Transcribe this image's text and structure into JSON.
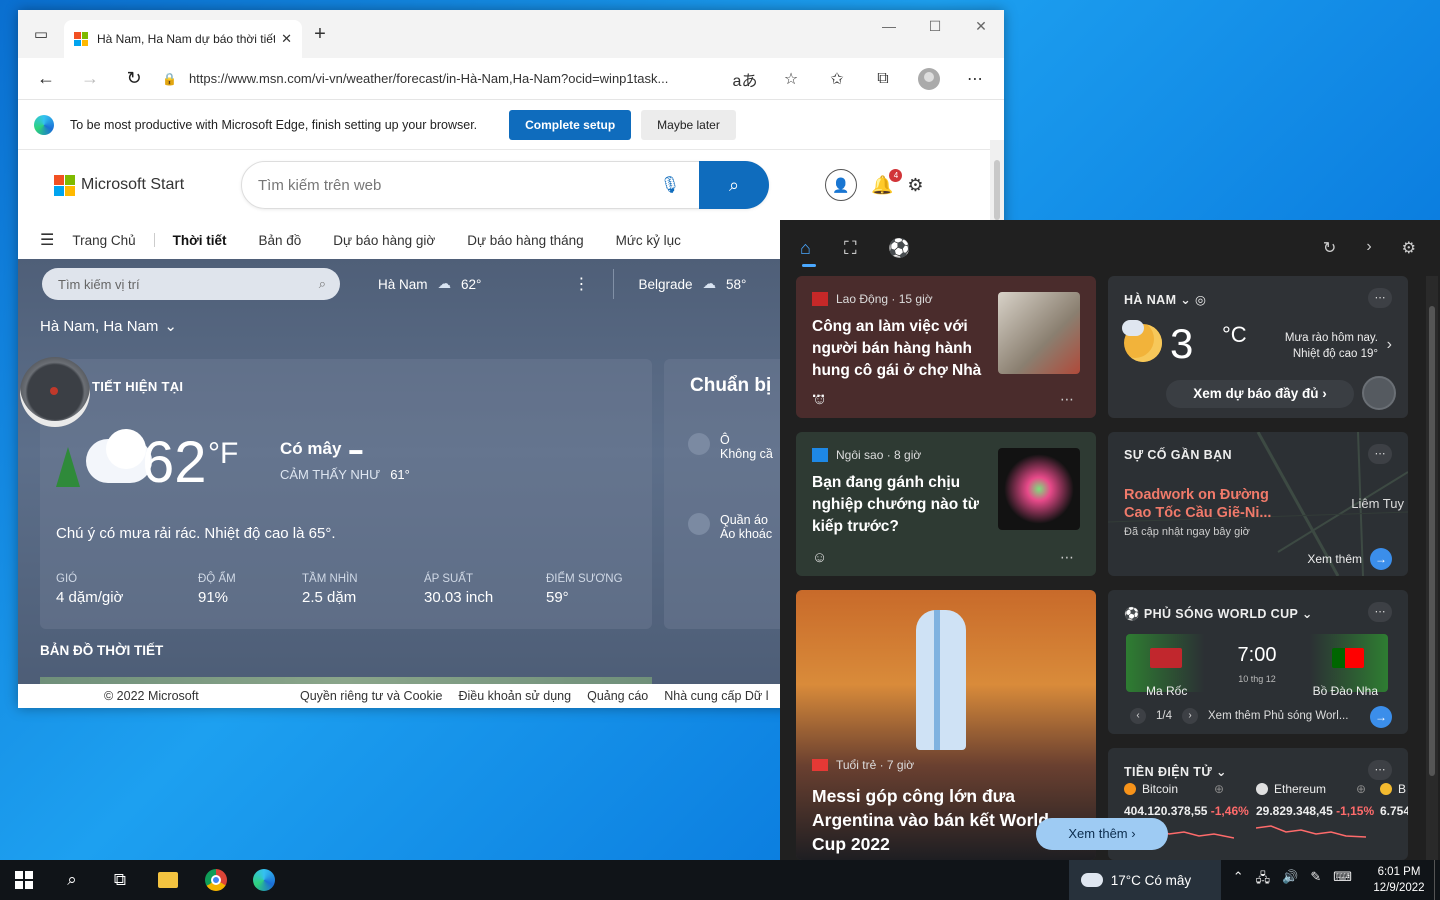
{
  "colors": {
    "accent": "#0f6cbd",
    "widget_bg": "#202020",
    "traffic_red": "#f07a6a",
    "crypto_down": "#ff6b6b"
  },
  "browser": {
    "tab_title": "Hà Nam, Ha Nam dự báo thời tiết",
    "url": "https://www.msn.com/vi-vn/weather/forecast/in-Hà-Nam,Ha-Nam?ocid=winp1task...",
    "setup_message": "To be most productive with Microsoft Edge, finish setting up your browser.",
    "complete_setup": "Complete setup",
    "maybe_later": "Maybe later"
  },
  "msn": {
    "brand": "Microsoft Start",
    "search_placeholder": "Tìm kiếm trên web",
    "notification_count": "4",
    "nav": [
      "Trang Chủ",
      "Thời tiết",
      "Bản đồ",
      "Dự báo hàng giờ",
      "Dự báo hàng tháng",
      "Mức kỷ lục"
    ]
  },
  "weather": {
    "location_search_placeholder": "Tìm kiếm vị trí",
    "saved_locations": [
      {
        "name": "Hà Nam",
        "temp": "62°"
      },
      {
        "name": "Belgrade",
        "temp": "58°"
      }
    ],
    "location_title": "Hà Nam, Ha Nam",
    "current_label": "TIẾT HIỆN TẠI",
    "temp": "62",
    "unit": "°F",
    "condition": "Có mây",
    "feels_label": "CẢM THẤY NHƯ",
    "feels_value": "61°",
    "description": "Chú ý có mưa rải rác. Nhiệt độ cao là 65°.",
    "stats": [
      {
        "label": "GIÓ",
        "value": "4 dặm/giờ"
      },
      {
        "label": "ĐỘ ẨM",
        "value": "91%"
      },
      {
        "label": "TẦM NHÌN",
        "value": "2.5 dặm"
      },
      {
        "label": "ÁP SUẤT",
        "value": "30.03 inch"
      },
      {
        "label": "ĐIỂM SƯƠNG",
        "value": "59°"
      }
    ],
    "map_title": "BẢN ĐỒ THỜI TIẾT",
    "side_title": "Chuẩn bị",
    "side_items": [
      {
        "title": "Ô",
        "sub": "Không cầ"
      },
      {
        "title": "Quần áo",
        "sub": "Áo khoác"
      }
    ]
  },
  "footer": {
    "copyright": "© 2022 Microsoft",
    "links": [
      "Quyền riêng tư và Cookie",
      "Điều khoản sử dụng",
      "Quảng cáo",
      "Nhà cung cấp Dữ l"
    ]
  },
  "widgets": {
    "news1": {
      "source": "Lao Động · 15 giờ",
      "title": "Công an làm việc với người bán hàng hành hung cô gái ở chợ Nhà ..."
    },
    "news2": {
      "source": "Ngôi sao · 8 giờ",
      "title": "Bạn đang gánh chịu nghiệp chướng nào từ kiếp trước?"
    },
    "news3": {
      "source": "Tuổi trẻ · 7 giờ",
      "title": "Messi góp công lớn đưa Argentina vào bán kết World Cup 2022"
    },
    "weather": {
      "location": "HÀ NAM",
      "temp": "3",
      "unit": "°C",
      "desc_line1": "Mưa rào hôm nay.",
      "desc_line2": "Nhiệt độ cao 19°",
      "full_forecast": "Xem dự báo đầy đủ"
    },
    "traffic": {
      "label": "SỰ CỐ GẦN BẠN",
      "title": "Roadwork on Đường Cao Tốc Cầu Giẽ-Ni...",
      "updated": "Đã cập nhật ngay bây giờ",
      "more": "Xem thêm",
      "map_label": "Liêm Tuy"
    },
    "worldcup": {
      "label": "PHỦ SÓNG WORLD CUP",
      "time": "7:00",
      "date": "10 thg 12",
      "team1": "Ma Rốc",
      "team2": "Bồ Đào Nha",
      "page": "1/4",
      "more": "Xem thêm Phủ sóng Worl..."
    },
    "crypto": {
      "label": "TIỀN ĐIỆN TỬ",
      "coins": [
        {
          "name": "Bitcoin",
          "value": "404.120.378,55",
          "change": "-1,46%"
        },
        {
          "name": "Ethereum",
          "value": "29.829.348,45",
          "change": "-1,15%"
        },
        {
          "name": "B",
          "value": "6.754",
          "change": ""
        }
      ]
    },
    "see_more": "Xem thêm"
  },
  "taskbar": {
    "weather": "17°C  Có mây",
    "time": "6:01 PM",
    "date": "12/9/2022"
  }
}
